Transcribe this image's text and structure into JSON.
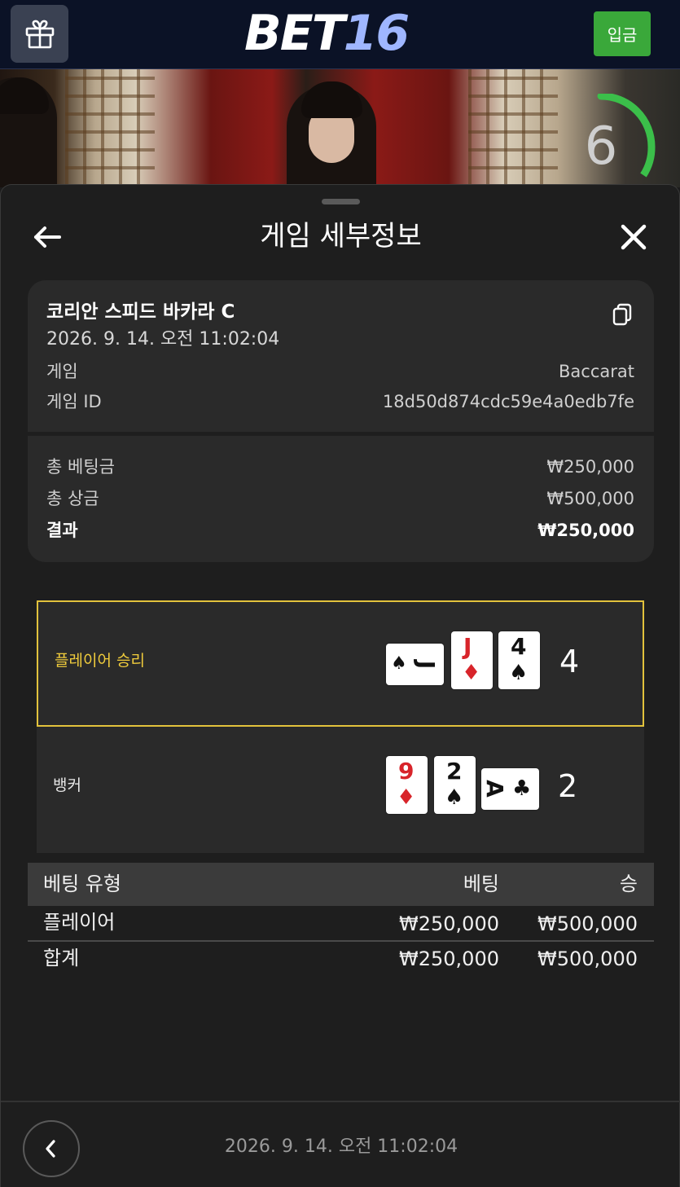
{
  "header": {
    "logo_main": "BET",
    "logo_num": "16",
    "deposit_label": "입금",
    "gift_icon": "gift-icon"
  },
  "stream": {
    "countdown": "6",
    "countdown_progress": 0.3
  },
  "sheet": {
    "title": "게임 세부정보",
    "back_icon": "arrow-left-icon",
    "close_icon": "close-icon"
  },
  "game": {
    "name": "코리안 스피드 바카라 C",
    "datetime": "2026. 9. 14. 오전 11:02:04",
    "game_label": "게임",
    "game_value": "Baccarat",
    "id_label": "게임 ID",
    "id_value": "18d50d874cdc59e4a0edb7fe",
    "copy_icon": "copy-icon"
  },
  "totals": {
    "total_bet_label": "총 베팅금",
    "total_bet_value": "₩250,000",
    "total_prize_label": "총 상금",
    "total_prize_value": "₩500,000",
    "result_label": "결과",
    "result_value": "₩250,000"
  },
  "hands": {
    "player": {
      "label": "플레이어 승리",
      "score": "4",
      "cards": [
        {
          "rank": "J",
          "suit": "♠",
          "color": "#111111",
          "orientation": "horizontal"
        },
        {
          "rank": "J",
          "suit": "♦",
          "color": "#d8242a",
          "orientation": "vertical"
        },
        {
          "rank": "4",
          "suit": "♠",
          "color": "#111111",
          "orientation": "vertical"
        }
      ]
    },
    "banker": {
      "label": "뱅커",
      "score": "2",
      "cards": [
        {
          "rank": "9",
          "suit": "♦",
          "color": "#d8242a",
          "orientation": "vertical"
        },
        {
          "rank": "2",
          "suit": "♠",
          "color": "#111111",
          "orientation": "vertical"
        },
        {
          "rank": "A",
          "suit": "♣",
          "color": "#111111",
          "orientation": "horizontal"
        }
      ]
    },
    "win_color": "#e2c23c"
  },
  "bets": {
    "headers": [
      "베팅 유형",
      "베팅",
      "승"
    ],
    "rows": [
      {
        "type": "플레이어",
        "bet": "₩250,000",
        "win": "₩500,000"
      }
    ],
    "total": {
      "type": "합계",
      "bet": "₩250,000",
      "win": "₩500,000"
    }
  },
  "footer": {
    "datetime": "2026. 9. 14. 오전 11:02:04",
    "prev_icon": "chevron-left-icon"
  }
}
